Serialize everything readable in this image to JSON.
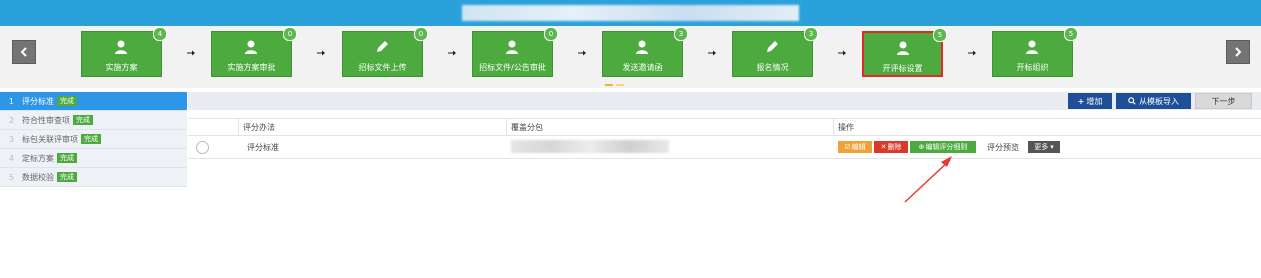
{
  "steps": [
    {
      "label": "实施方案",
      "badge": "4",
      "icon": "user-icon"
    },
    {
      "label": "实施方案审批",
      "badge": "0",
      "icon": "user-icon"
    },
    {
      "label": "招标文件上传",
      "badge": "0",
      "icon": "pencil-icon"
    },
    {
      "label": "招标文件/公告审批",
      "badge": "0",
      "icon": "user-icon"
    },
    {
      "label": "发送邀请函",
      "badge": "3",
      "icon": "user-icon"
    },
    {
      "label": "报名情况",
      "badge": "3",
      "icon": "pencil-icon"
    },
    {
      "label": "开评标设置",
      "badge": "5",
      "icon": "user-icon",
      "active": true
    },
    {
      "label": "开标组织",
      "badge": "5",
      "icon": "user-icon"
    }
  ],
  "menu": {
    "done_label": "完成",
    "items": [
      {
        "num": "1",
        "label": "评分标准",
        "active": true
      },
      {
        "num": "2",
        "label": "符合性审查项"
      },
      {
        "num": "3",
        "label": "标包关联评审项"
      },
      {
        "num": "4",
        "label": "定标方案"
      },
      {
        "num": "5",
        "label": "数据校验"
      }
    ]
  },
  "toolbar": {
    "add_label": "增加",
    "template_label": "从模板导入",
    "next_label": "下一步"
  },
  "table": {
    "headers": [
      "评分办法",
      "覆盖分包",
      "操作"
    ],
    "rows": [
      {
        "method": "评分标准"
      }
    ],
    "actions": {
      "edit": "编辑",
      "delete": "删除",
      "edit_rules": "编辑评分细则",
      "preview": "评分预览",
      "more": "更多"
    }
  },
  "colors": {
    "topbar": "#2ba1db",
    "step_green": "#4caa3f",
    "active_border": "#e02a2a",
    "menu_active": "#2e96e6",
    "primary_button": "#1f4f99",
    "edit_orange": "#f0a23a",
    "delete_red": "#d93a2b"
  }
}
